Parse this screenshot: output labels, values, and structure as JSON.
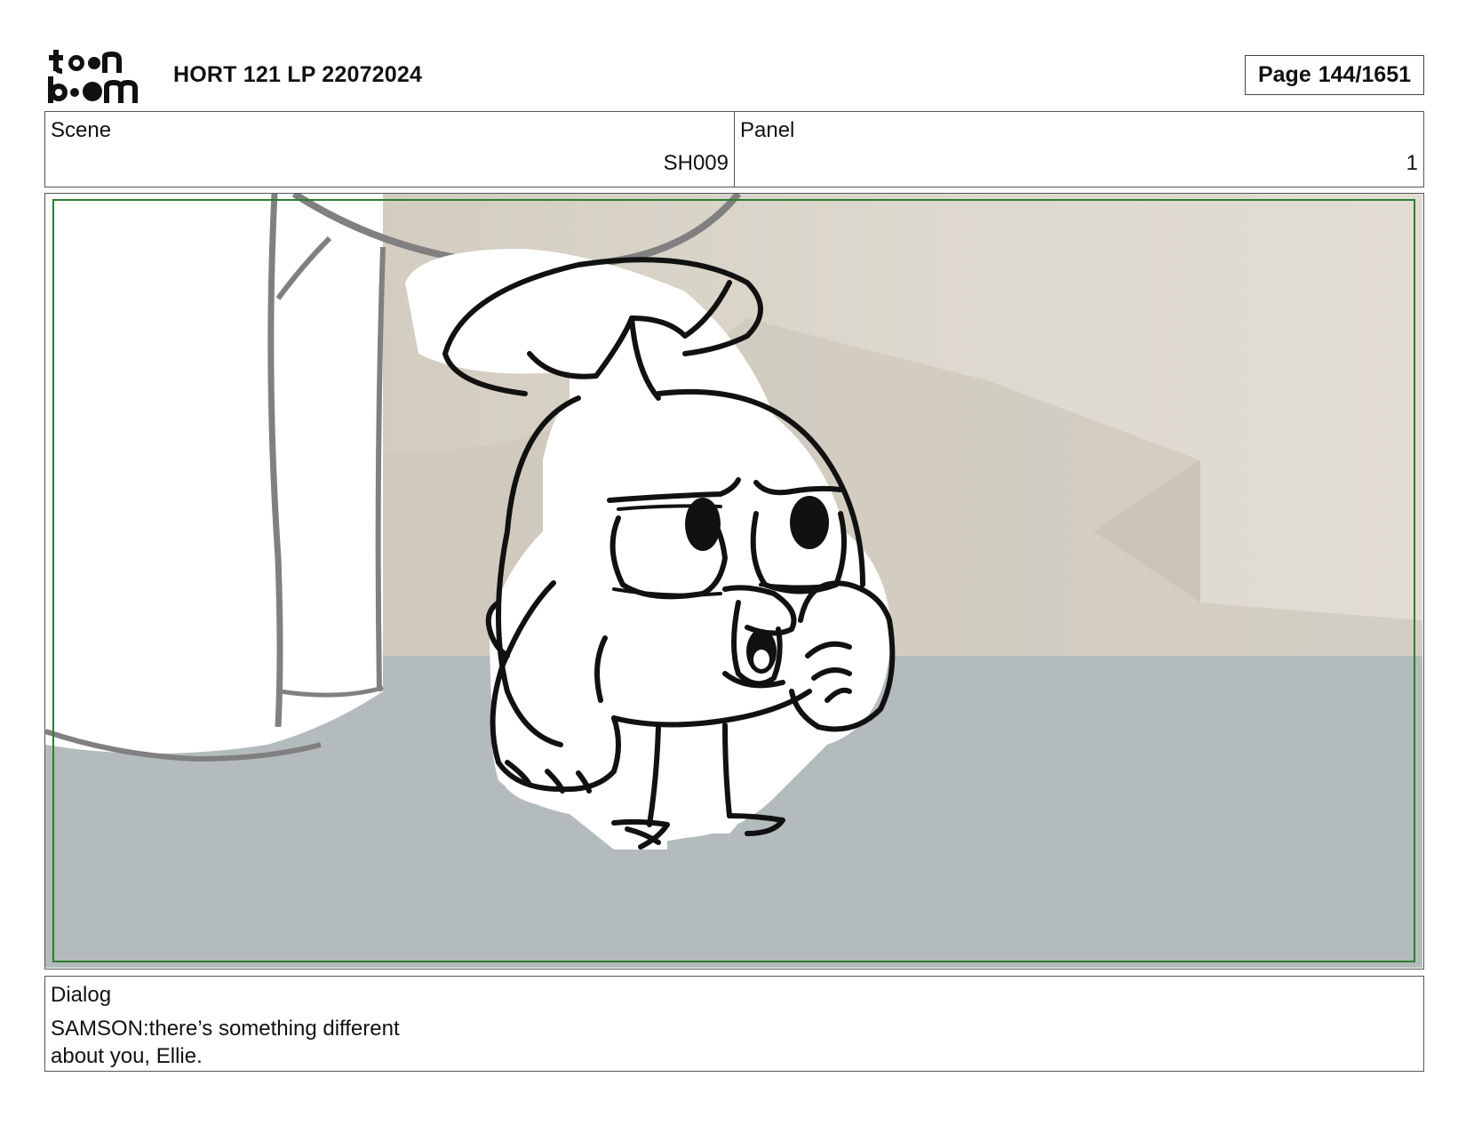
{
  "header": {
    "logo_alt": "toon boom",
    "title": "HORT 121 LP 22072024",
    "page_label": "Page",
    "page_value": "144/1651"
  },
  "scene": {
    "label": "Scene",
    "value": "SH009"
  },
  "panel": {
    "label": "Panel",
    "value": "1"
  },
  "dialog": {
    "label": "Dialog",
    "text": " SAMSON:there’s something different\nabout you, Ellie."
  },
  "colors": {
    "frame_border": "#2f7d32",
    "floor": "#b4bbbc",
    "wall": "#d8d3c8",
    "ink": "#111111",
    "foreground_ink": "#808080"
  }
}
